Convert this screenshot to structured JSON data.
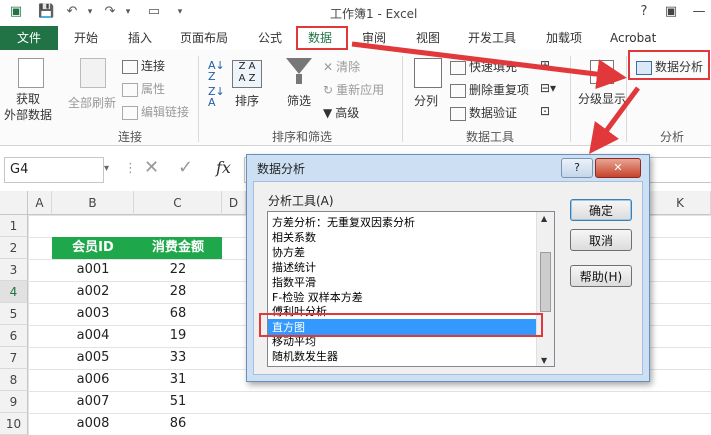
{
  "window": {
    "title": "工作簿1 - Excel"
  },
  "tabs": [
    "文件",
    "开始",
    "插入",
    "页面布局",
    "公式",
    "数据",
    "审阅",
    "视图",
    "开发工具",
    "加载项",
    "Acrobat"
  ],
  "ribbon": {
    "get_external_line1": "获取",
    "get_external_line2": "外部数据",
    "refresh_all": "全部刷新",
    "connections": "连接",
    "properties": "属性",
    "edit_links": "编辑链接",
    "group_connections": "连接",
    "sort": "排序",
    "filter": "筛选",
    "clear": "清除",
    "reapply": "重新应用",
    "advanced": "高级",
    "group_sort_filter": "排序和筛选",
    "text_to_columns": "分列",
    "flash_fill": "快速填充",
    "remove_duplicates": "删除重复项",
    "data_validation": "数据验证",
    "group_data_tools": "数据工具",
    "outline": "分级显示",
    "data_analysis": "数据分析",
    "group_analysis": "分析"
  },
  "formula_bar": {
    "name_box": "G4",
    "fx": "fx"
  },
  "sheet": {
    "columns": [
      "A",
      "B",
      "C",
      "D",
      "K"
    ],
    "rows": [
      "1",
      "2",
      "3",
      "4",
      "5",
      "6",
      "7",
      "8",
      "9",
      "10"
    ],
    "headers": [
      "会员ID",
      "消费金额"
    ],
    "data": [
      [
        "a001",
        "22"
      ],
      [
        "a002",
        "28"
      ],
      [
        "a003",
        "68"
      ],
      [
        "a004",
        "19"
      ],
      [
        "a005",
        "33"
      ],
      [
        "a006",
        "31"
      ],
      [
        "a007",
        "51"
      ],
      [
        "a008",
        "86"
      ]
    ]
  },
  "dialog": {
    "title": "数据分析",
    "help_icon": "?",
    "close_icon": "✕",
    "list_label": "分析工具(A)",
    "items": [
      "方差分析：无重复双因素分析",
      "相关系数",
      "协方差",
      "描述统计",
      "指数平滑",
      "F-检验 双样本方差",
      "傅利叶分析",
      "直方图",
      "移动平均",
      "随机数发生器"
    ],
    "selected_item": "直方图",
    "ok": "确定",
    "cancel": "取消",
    "help": "帮助(H)"
  },
  "colors": {
    "excel_green": "#217346",
    "table_header_green": "#1fa74b",
    "selection_blue": "#3399ff",
    "annotation_red": "#e0383b"
  }
}
